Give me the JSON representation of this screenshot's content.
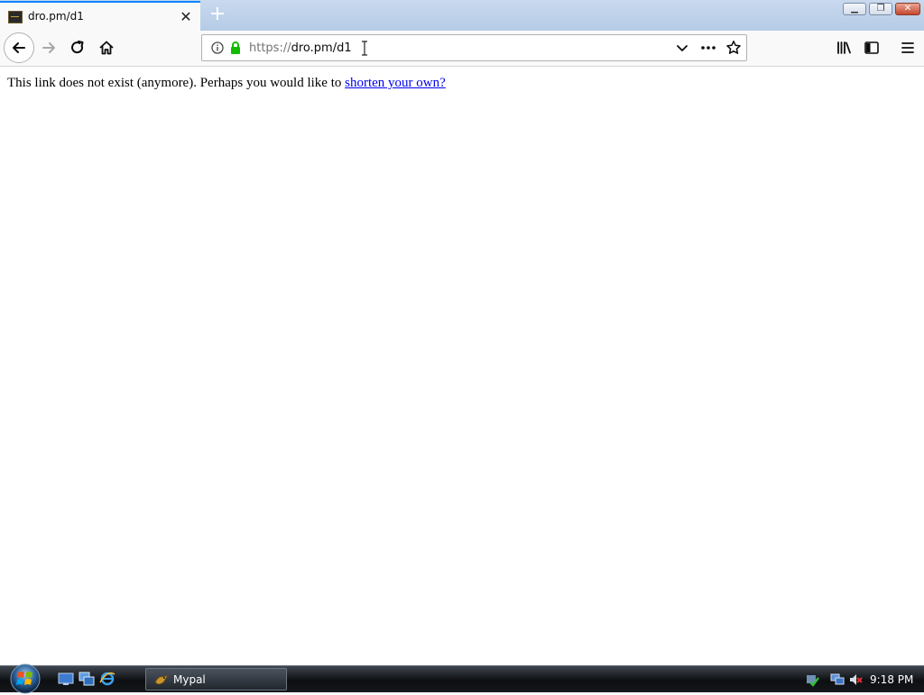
{
  "tab": {
    "title": "dro.pm/d1",
    "favicon": "site-favicon"
  },
  "toolbar": {
    "url_scheme": "https://",
    "url_host_path": "dro.pm/d1",
    "icons": [
      "back-icon",
      "forward-icon",
      "reload-icon",
      "home-icon",
      "info-icon",
      "lock-icon",
      "dropdown-icon",
      "page-actions-icon",
      "bookmark-star-icon",
      "library-icon",
      "sidebar-icon",
      "menu-icon"
    ]
  },
  "page": {
    "message_prefix": "This link does not exist (anymore). Perhaps you would like to ",
    "link_text": "shorten your own?"
  },
  "taskbar": {
    "task_label": "Mypal",
    "clock": "9:18 PM"
  },
  "colors": {
    "tab_accent": "#0a84ff",
    "link": "#0000ee",
    "lock_green": "#12bc00"
  }
}
